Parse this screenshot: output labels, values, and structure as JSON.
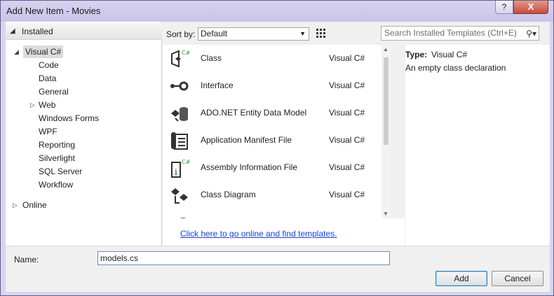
{
  "window": {
    "title": "Add New Item - Movies",
    "help_label": "?",
    "close_label": "X"
  },
  "tree": {
    "installed_label": "Installed",
    "root_label": "Visual C#",
    "children": [
      "Code",
      "Data",
      "General",
      "Web",
      "Windows Forms",
      "WPF",
      "Reporting",
      "Silverlight",
      "SQL Server",
      "Workflow"
    ],
    "online_label": "Online"
  },
  "toolbar": {
    "sort_label": "Sort by:",
    "sort_value": "Default",
    "search_placeholder": "Search Installed Templates (Ctrl+E)"
  },
  "templates": [
    {
      "name": "Class",
      "lang": "Visual C#",
      "icon": "class-icon"
    },
    {
      "name": "Interface",
      "lang": "Visual C#",
      "icon": "interface-icon"
    },
    {
      "name": "ADO.NET Entity Data Model",
      "lang": "Visual C#",
      "icon": "entity-model-icon"
    },
    {
      "name": "Application Manifest File",
      "lang": "Visual C#",
      "icon": "manifest-icon"
    },
    {
      "name": "Assembly Information File",
      "lang": "Visual C#",
      "icon": "assembly-info-icon"
    },
    {
      "name": "Class Diagram",
      "lang": "Visual C#",
      "icon": "class-diagram-icon"
    }
  ],
  "online_link": "Click here to go online and find templates.",
  "details": {
    "type_key": "Type:",
    "type_value": "Visual C#",
    "description": "An empty class declaration"
  },
  "form": {
    "name_label": "Name:",
    "name_value": "models.cs"
  },
  "buttons": {
    "add": "Add",
    "cancel": "Cancel"
  }
}
